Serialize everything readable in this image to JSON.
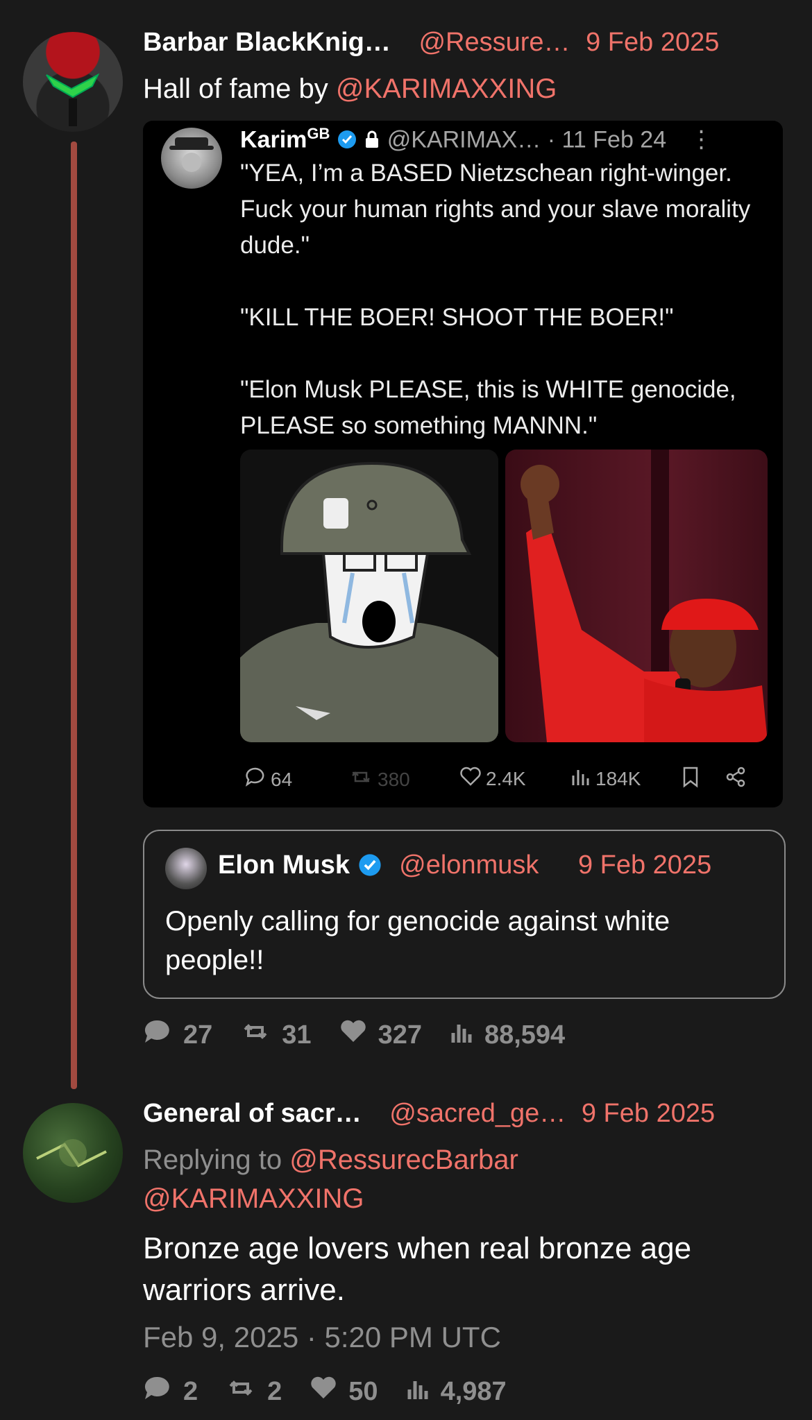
{
  "colors": {
    "background": "#1a1a1a",
    "accent": "#f0736a",
    "thread_line": "#a24a40",
    "muted": "#8f8f8f"
  },
  "post1": {
    "name": "Barbar BlackKnig…",
    "handle": "@Ressure…",
    "date": "9 Feb 2025",
    "text": "Hall of fame by ",
    "mention": "@KARIMAXXING",
    "replies": "27",
    "reposts": "31",
    "likes": "327",
    "views": "88,594"
  },
  "embedded": {
    "name": "Karim",
    "name_sup": "GB",
    "handle": "@KARIMAX…",
    "date": "· 11 Feb 24",
    "text": "\"YEA, I’m a BASED Nietzschean right-winger. Fuck your human rights and your slave morality dude.\"\n\n\"KILL THE BOER! SHOOT THE BOER!\"\n\n\"Elon Musk PLEASE, this is WHITE genocide, PLEASE so something MANNN.\"",
    "replies": "64",
    "reposts": "380",
    "likes": "2.4K",
    "views": "184K"
  },
  "quote": {
    "name": "Elon Musk",
    "handle": "@elonmusk",
    "date": "9 Feb 2025",
    "text": "Openly calling for genocide against white people!!"
  },
  "post2": {
    "name": "General of sacr…",
    "handle": "@sacred_ge…",
    "date": "9 Feb 2025",
    "replying_prefix": "Replying to ",
    "replying_1": "@RessurecBarbar",
    "replying_2": "@KARIMAXXING",
    "text": "Bronze age lovers when real bronze age warriors arrive.",
    "timestamp": "Feb 9, 2025 · 5:20 PM UTC",
    "replies": "2",
    "reposts": "2",
    "likes": "50",
    "views": "4,987"
  },
  "icons": [
    "reply-icon",
    "repost-icon",
    "like-icon",
    "views-icon",
    "bookmark-icon",
    "share-icon",
    "verified-icon",
    "lock-icon",
    "more-icon"
  ]
}
